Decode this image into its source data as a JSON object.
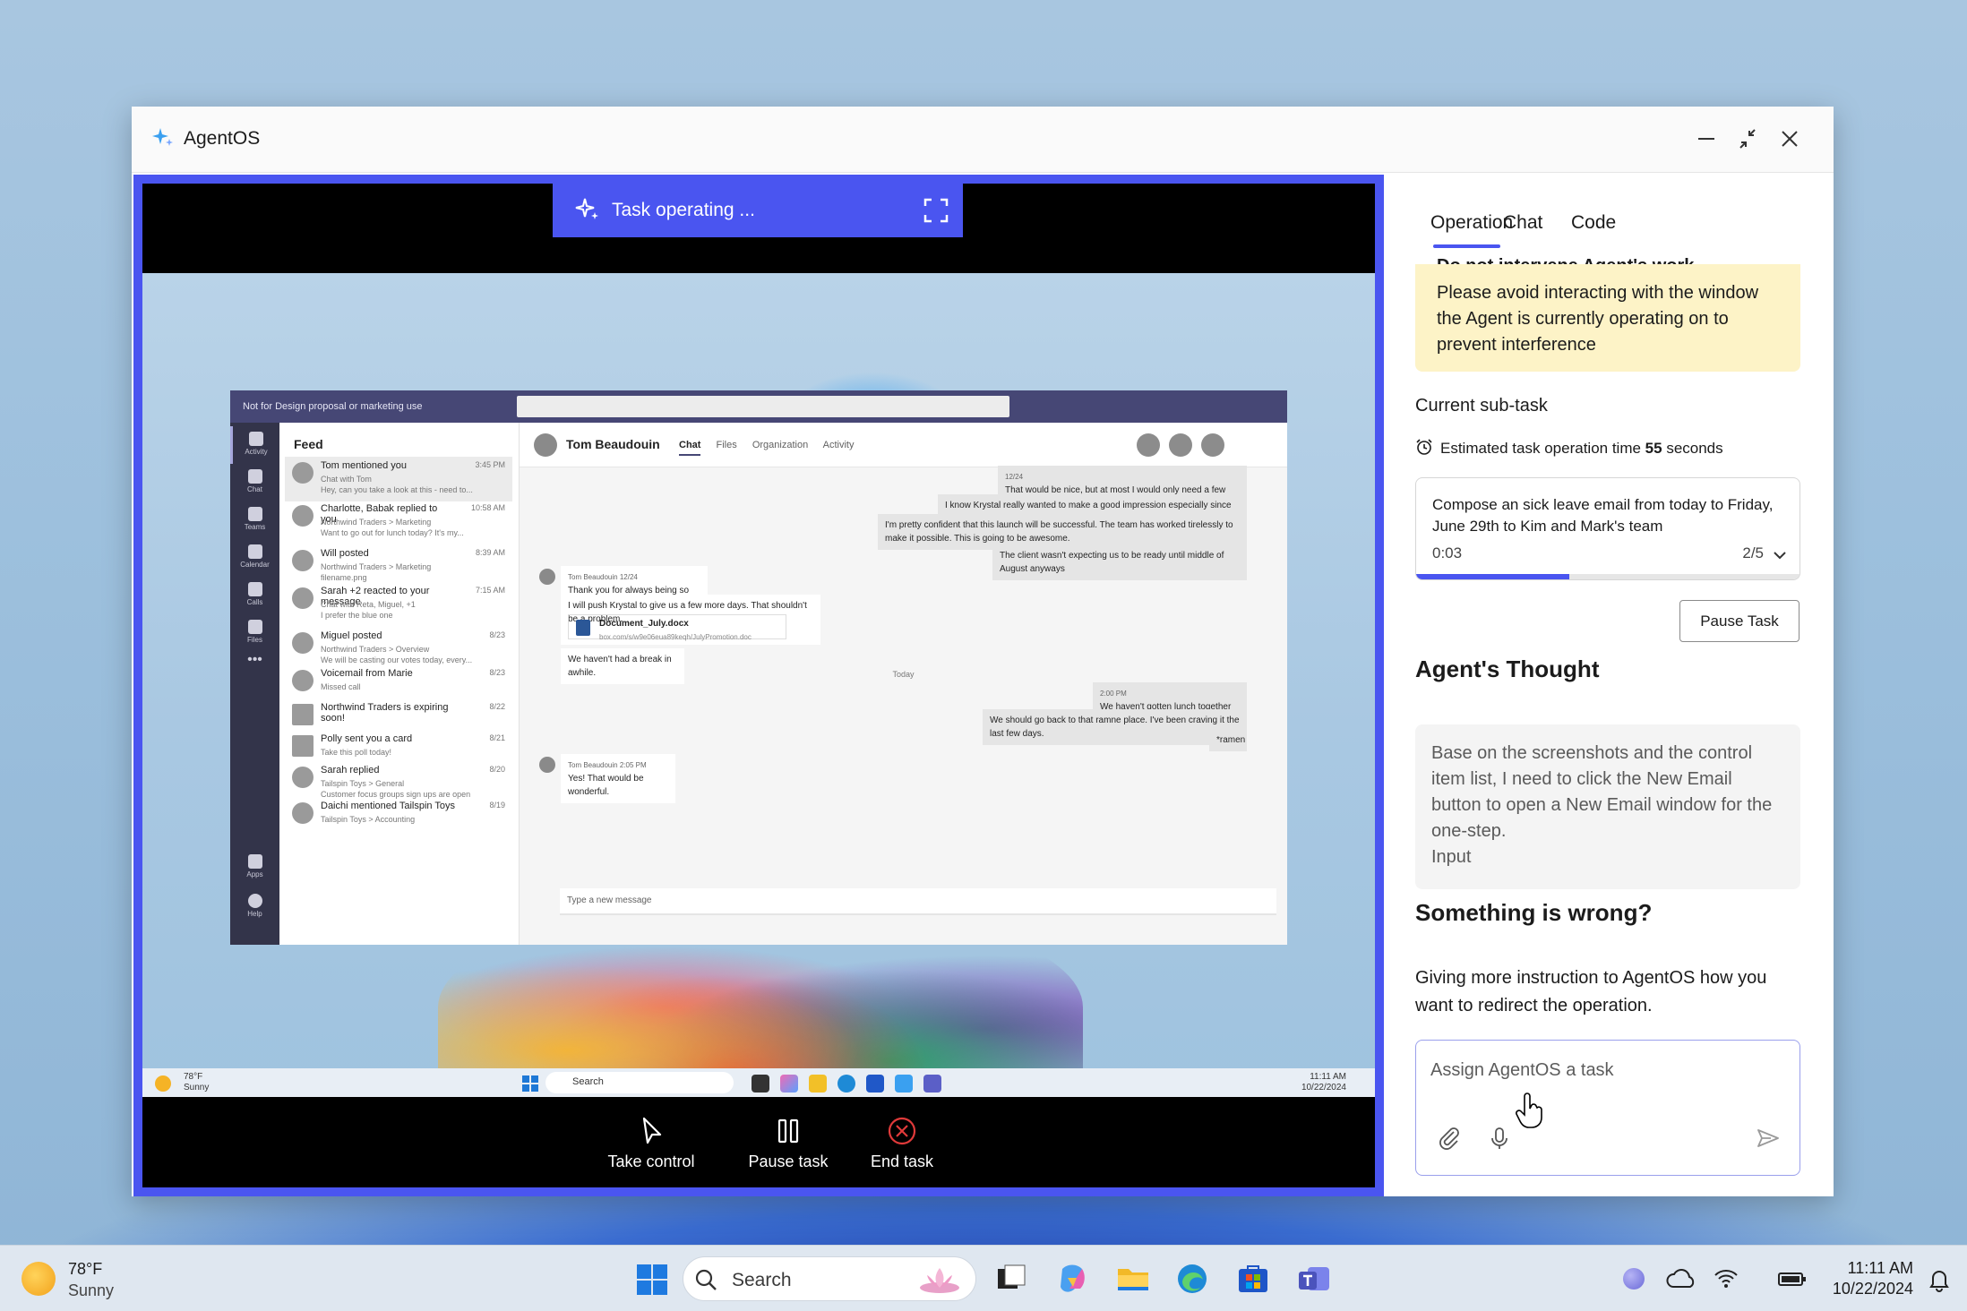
{
  "app": {
    "title": "AgentOS"
  },
  "viewer": {
    "banner_label": "Task operating ...",
    "controls": {
      "take_control": "Take control",
      "pause_task": "Pause task",
      "end_task": "End task"
    }
  },
  "teams": {
    "notice": "Not for Design proposal or marketing use",
    "rail": [
      "Activity",
      "Chat",
      "Teams",
      "Calendar",
      "Calls",
      "Files",
      "Apps",
      "Help"
    ],
    "feed_title": "Feed",
    "feed": [
      {
        "title": "Tom mentioned you",
        "sub": "Chat with Tom",
        "sub2": "Hey, can you take a look at this - need to...",
        "time": "3:45 PM"
      },
      {
        "title": "Charlotte, Babak replied to you",
        "sub": "Northwind Traders > Marketing",
        "sub2": "Want to go out for lunch today? It's my...",
        "time": "10:58 AM"
      },
      {
        "title": "Will posted",
        "sub": "Northwind Traders > Marketing",
        "sub2": "filename.png",
        "time": "8:39 AM"
      },
      {
        "title": "Sarah +2 reacted to your message",
        "sub": "Chat with Reta, Miguel, +1",
        "sub2": "I prefer the blue one",
        "time": "7:15 AM"
      },
      {
        "title": "Miguel posted",
        "sub": "Northwind Traders > Overview",
        "sub2": "We will be casting our votes today, every...",
        "time": "8/23"
      },
      {
        "title": "Voicemail from Marie",
        "sub": "Missed call",
        "sub2": "",
        "time": "8/23"
      },
      {
        "title": "Northwind Traders is expiring soon!",
        "sub": "",
        "sub2": "",
        "time": "8/22"
      },
      {
        "title": "Polly sent you a card",
        "sub": "Take this poll today!",
        "sub2": "",
        "time": "8/21"
      },
      {
        "title": "Sarah replied",
        "sub": "Tailspin Toys > General",
        "sub2": "Customer focus groups sign ups are open",
        "time": "8/20"
      },
      {
        "title": "Daichi mentioned Tailspin Toys",
        "sub": "Tailspin Toys > Accounting",
        "sub2": "",
        "time": "8/19"
      }
    ],
    "chat_name": "Tom Beaudouin",
    "chat_tabs": [
      "Chat",
      "Files",
      "Organization",
      "Activity"
    ],
    "messages": {
      "m1_time": "12/24",
      "m1": "That would be nice, but at most I would only need a few additional days.",
      "m2": "I know Krystal really wanted to make a good impression especially since this is a new client.",
      "m3": "I'm pretty confident that this launch will be successful. The team has worked tirelessly to make it possible. This is going to be awesome.",
      "m4": "The client wasn't expecting us to be ready until middle of August anyways",
      "m5_head": "Tom Beaudouin   12/24",
      "m5": "Thank you for always being so positive!",
      "m6": "I will push Krystal to give us a few more days. That shouldn't be a problem.",
      "file_name": "Document_July.docx",
      "file_path": "box.com/s/w9e06eua89keqh/JulyPromotion.doc",
      "m7": "We haven't had a break in awhile.",
      "divider": "Today",
      "m8_time": "2:00 PM",
      "m8": "We haven't gotten lunch together in awhile",
      "m9": "We should go back to that ramne place. I've been craving it the last few days.",
      "m10": "*ramen",
      "m11_head": "Tom Beaudouin   2:05 PM",
      "m11": "Yes! That would be wonderful.",
      "compose": "Type a new message"
    },
    "taskbar": {
      "temp": "78°F",
      "cond": "Sunny",
      "search": "Search",
      "time": "11:11 AM",
      "date": "10/22/2024"
    }
  },
  "panel": {
    "tabs": [
      "Operation",
      "Chat",
      "Code"
    ],
    "warning_title": "Do not intervene Agent's work",
    "warning_text": "Please avoid interacting with the window the Agent is currently operating on to prevent interference",
    "current_subtask_label": "Current sub-task",
    "estimate_prefix": "Estimated task operation time ",
    "estimate_value": "55",
    "estimate_suffix": " seconds",
    "subtask": {
      "description": "Compose an sick leave email from today to Friday, June 29th to Kim and Mark's team",
      "elapsed": "0:03",
      "step": "2/5",
      "progress": 0.4
    },
    "pause_button": "Pause Task",
    "thought_heading": "Agent's Thought",
    "thought_text": "Base on the screenshots and the control item list, I need to click the New Email button to open a New Email window for the one-step.\nInput",
    "wrong_heading": "Something is wrong?",
    "wrong_text": "Giving more instruction to AgentOS how you want to redirect the operation.",
    "assign_placeholder": "Assign AgentOS a task"
  },
  "taskbar": {
    "temp": "78°F",
    "cond": "Sunny",
    "search": "Search",
    "time": "11:11 AM",
    "date": "10/22/2024"
  },
  "colors": {
    "accent": "#4a55f0",
    "warning_bg": "#fdf3c7"
  }
}
